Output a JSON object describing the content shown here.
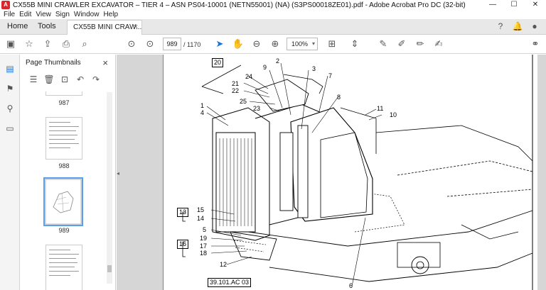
{
  "window": {
    "title": "CX55B MINI CRAWLER EXCAVATOR – TIER 4 – ASN PS04-10001 (NETN55001) (NA) (S3PS00018ZE01).pdf - Adobe Acrobat Pro DC (32-bit)"
  },
  "menu": [
    "File",
    "Edit",
    "View",
    "Sign",
    "Window",
    "Help"
  ],
  "tabs": {
    "home": "Home",
    "tools": "Tools",
    "document": "CX55B MINI CRAW...",
    "close": "×"
  },
  "toolbar": {
    "current_page": "989",
    "page_total": "/ 1170",
    "zoom": "100%"
  },
  "panel": {
    "title": "Page Thumbnails",
    "thumbs": [
      {
        "label": "987"
      },
      {
        "label": "988"
      },
      {
        "label": "989"
      }
    ]
  },
  "drawing": {
    "reference": "39.101.AC 03",
    "callouts": [
      {
        "n": "20"
      },
      {
        "n": "9"
      },
      {
        "n": "2"
      },
      {
        "n": "3"
      },
      {
        "n": "24"
      },
      {
        "n": "7"
      },
      {
        "n": "21"
      },
      {
        "n": "22"
      },
      {
        "n": "25"
      },
      {
        "n": "8"
      },
      {
        "n": "23"
      },
      {
        "n": "1"
      },
      {
        "n": "4"
      },
      {
        "n": "11"
      },
      {
        "n": "10"
      },
      {
        "n": "13"
      },
      {
        "n": "15"
      },
      {
        "n": "14"
      },
      {
        "n": "5"
      },
      {
        "n": "16"
      },
      {
        "n": "19"
      },
      {
        "n": "17"
      },
      {
        "n": "18"
      },
      {
        "n": "12"
      },
      {
        "n": "6"
      }
    ]
  },
  "colors": {
    "accent": "#1473e6",
    "acrobat_red": "#d9262b",
    "viewer_bg": "#d6d6d6"
  }
}
